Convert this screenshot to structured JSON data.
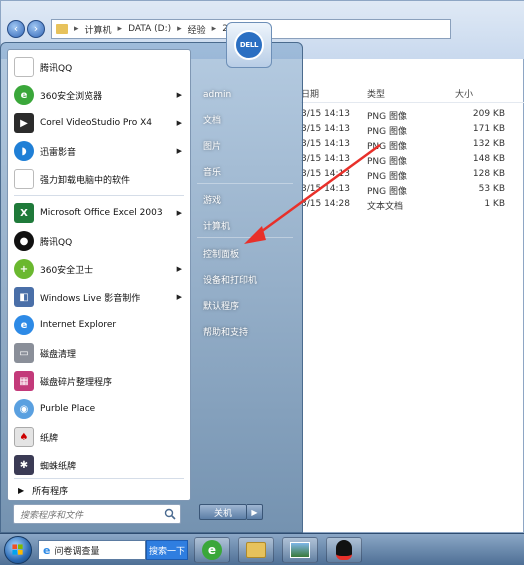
{
  "explorer": {
    "breadcrumb": [
      "计算机",
      "DATA (D:)",
      "经验",
      "2"
    ],
    "columns": {
      "type": "类型",
      "size": "大小",
      "date_partial": "日期"
    },
    "files": [
      {
        "date": "3/15 14:13",
        "type": "PNG 图像",
        "size": "209 KB"
      },
      {
        "date": "3/15 14:13",
        "type": "PNG 图像",
        "size": "171 KB"
      },
      {
        "date": "3/15 14:13",
        "type": "PNG 图像",
        "size": "132 KB"
      },
      {
        "date": "3/15 14:13",
        "type": "PNG 图像",
        "size": "148 KB"
      },
      {
        "date": "3/15 14:13",
        "type": "PNG 图像",
        "size": "128 KB"
      },
      {
        "date": "3/15 14:13",
        "type": "PNG 图像",
        "size": "53 KB"
      },
      {
        "date": "3/15 14:28",
        "type": "文本文档",
        "size": "1 KB"
      }
    ]
  },
  "startmenu": {
    "left_items": [
      {
        "label": "腾讯QQ",
        "icon": "document-icon",
        "color": "#ffffff",
        "arrow": false
      },
      {
        "label": "360安全浏览器",
        "icon": "browser-360-icon",
        "color": "#3aa73a",
        "arrow": true
      },
      {
        "label": "Corel VideoStudio Pro X4",
        "icon": "video-studio-icon",
        "color": "#2b2b2b",
        "arrow": true
      },
      {
        "label": "迅雷影音",
        "icon": "xunlei-player-icon",
        "color": "#1f7fd6",
        "arrow": true
      },
      {
        "label": "强力卸载电脑中的软件",
        "icon": "document-icon",
        "color": "#ffffff",
        "arrow": false
      },
      {
        "label": "Microsoft Office Excel 2003",
        "icon": "excel-icon",
        "color": "#1f7a3a",
        "arrow": true
      },
      {
        "label": "腾讯QQ",
        "icon": "qq-penguin-icon",
        "color": "#111111",
        "arrow": false
      },
      {
        "label": "360安全卫士",
        "icon": "security-360-icon",
        "color": "#6ab82f",
        "arrow": true
      },
      {
        "label": "Windows Live 影音制作",
        "icon": "movie-maker-icon",
        "color": "#4a6fa8",
        "arrow": true
      },
      {
        "label": "Internet Explorer",
        "icon": "ie-icon",
        "color": "#2d8ae6",
        "arrow": false
      },
      {
        "label": "磁盘清理",
        "icon": "disk-cleanup-icon",
        "color": "#8a8f99",
        "arrow": false
      },
      {
        "label": "磁盘碎片整理程序",
        "icon": "defrag-icon",
        "color": "#c33a7a",
        "arrow": false
      },
      {
        "label": "Purble Place",
        "icon": "purble-place-icon",
        "color": "#5aa0e0",
        "arrow": false
      },
      {
        "label": "纸牌",
        "icon": "solitaire-icon",
        "color": "#e4e4e4",
        "arrow": false
      },
      {
        "label": "蜘蛛纸牌",
        "icon": "spider-solitaire-icon",
        "color": "#3b3b55",
        "arrow": false
      }
    ],
    "all_programs": "所有程序",
    "search_placeholder": "搜索程序和文件",
    "right_items": [
      "admin",
      "文档",
      "图片",
      "音乐",
      "游戏",
      "计算机",
      "控制面板",
      "设备和打印机",
      "默认程序",
      "帮助和支持"
    ],
    "shutdown": "关机",
    "badge_text": "DELL"
  },
  "taskbar": {
    "search_text": "问卷调查量",
    "search_button": "搜索一下",
    "apps": [
      "ie-icon",
      "explorer-folder-icon",
      "photo-viewer-icon",
      "qq-penguin-icon"
    ]
  },
  "colors": {
    "accent_red": "#e8302a",
    "highlight": "#2f7ee0"
  }
}
